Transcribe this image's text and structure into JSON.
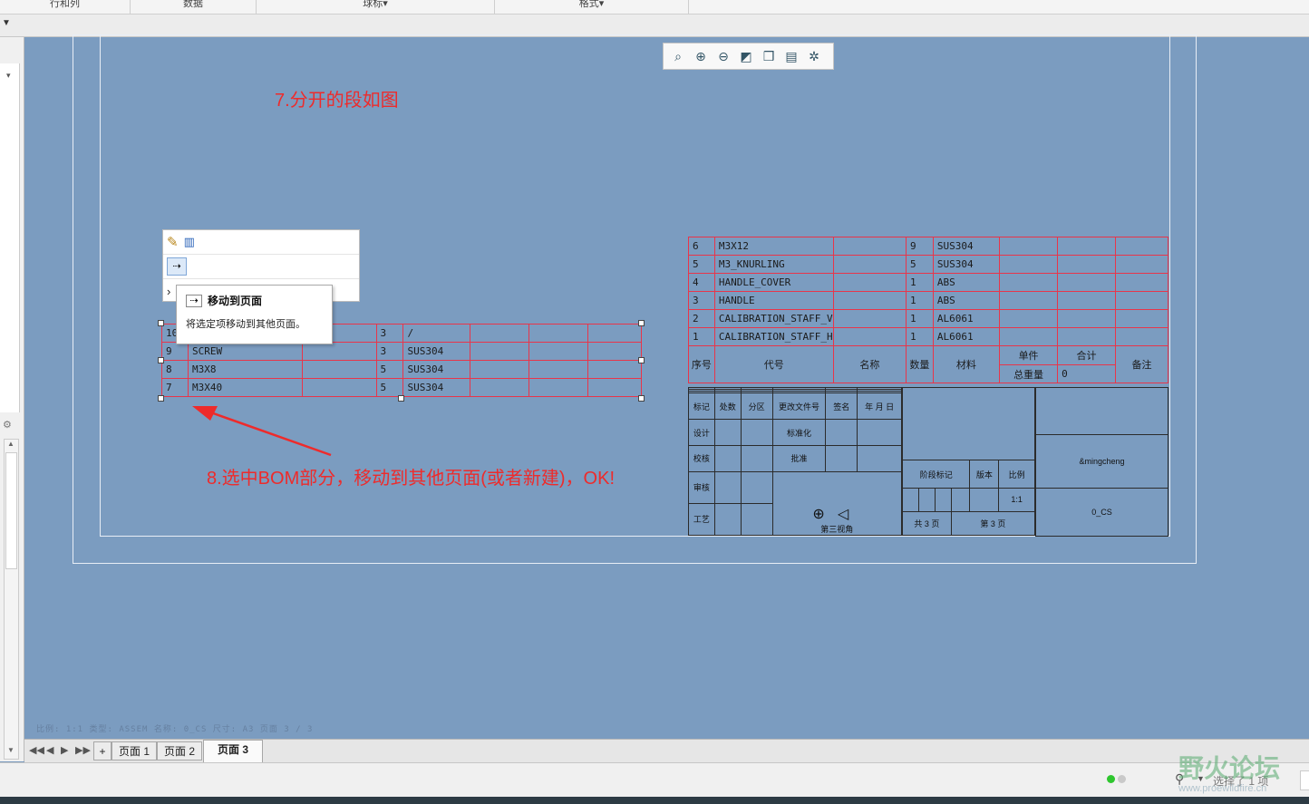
{
  "ribbon": {
    "groups": [
      "行和列",
      "数据",
      "球标",
      "格式"
    ]
  },
  "zoom_toolbar": {
    "icons": [
      "zoom-fit-icon",
      "zoom-in-icon",
      "zoom-out-icon",
      "refit-icon",
      "display-style-icon",
      "saved-views-icon",
      "repaint-icon"
    ]
  },
  "annotations": {
    "step7": "7.分开的段如图",
    "step8": "8.选中BOM部分，移动到其他页面(或者新建)，OK!"
  },
  "context_menu": {
    "tooltip_title": "移动到页面",
    "tooltip_desc": "将选定项移动到其他页面。"
  },
  "bom_left_rows": [
    [
      "10",
      "",
      "",
      "3",
      "/",
      "",
      "",
      ""
    ],
    [
      "9",
      "SCREW",
      "",
      "3",
      "SUS304",
      "",
      "",
      ""
    ],
    [
      "8",
      "M3X8",
      "",
      "5",
      "SUS304",
      "",
      "",
      ""
    ],
    [
      "7",
      "M3X40",
      "",
      "5",
      "SUS304",
      "",
      "",
      ""
    ]
  ],
  "bom_right_rows": [
    [
      "6",
      "M3X12",
      "",
      "9",
      "SUS304",
      "",
      "",
      ""
    ],
    [
      "5",
      "M3_KNURLING",
      "",
      "5",
      "SUS304",
      "",
      "",
      ""
    ],
    [
      "4",
      "HANDLE_COVER",
      "",
      "1",
      "ABS",
      "",
      "",
      ""
    ],
    [
      "3",
      "HANDLE",
      "",
      "1",
      "ABS",
      "",
      "",
      ""
    ],
    [
      "2",
      "CALIBRATION_STAFF_V",
      "",
      "1",
      "AL6061",
      "",
      "",
      ""
    ],
    [
      "1",
      "CALIBRATION_STAFF_H",
      "",
      "1",
      "AL6061",
      "",
      "",
      ""
    ]
  ],
  "bom_header": {
    "seq": "序号",
    "code": "代号",
    "name": "名称",
    "qty": "数量",
    "material": "材料",
    "unit": "单件",
    "total": "合计",
    "total_weight": "总重量",
    "weight_value": "0",
    "remark": "备注"
  },
  "title_block": {
    "marks": "标记",
    "count": "处数",
    "zone": "分区",
    "change_doc": "更改文件号",
    "sign": "签名",
    "date": "年 月 日",
    "design": "设计",
    "standardize": "标准化",
    "check": "校核",
    "approve": "批准",
    "review": "审核",
    "process": "工艺",
    "stage_mark": "阶段标记",
    "version": "版本",
    "scale": "比例",
    "scale_value": "1:1",
    "sheets": "共 3 页",
    "sheet_no": "第 3 页",
    "projection": "第三视角",
    "name_param": "&mingcheng",
    "model_name": "0_CS"
  },
  "status_faint": "比例: 1:1    类型: ASSEM    名称: 0_CS    尺寸: A3    页面 3 / 3",
  "page_tabs": {
    "add": "+",
    "tabs": [
      "页面 1",
      "页面 2",
      "页面 3"
    ],
    "active": "页面 3"
  },
  "status": {
    "selection": "选择了 1 项"
  },
  "watermark": {
    "brand": "野火论坛",
    "site": "www.proewildfire.cn"
  }
}
